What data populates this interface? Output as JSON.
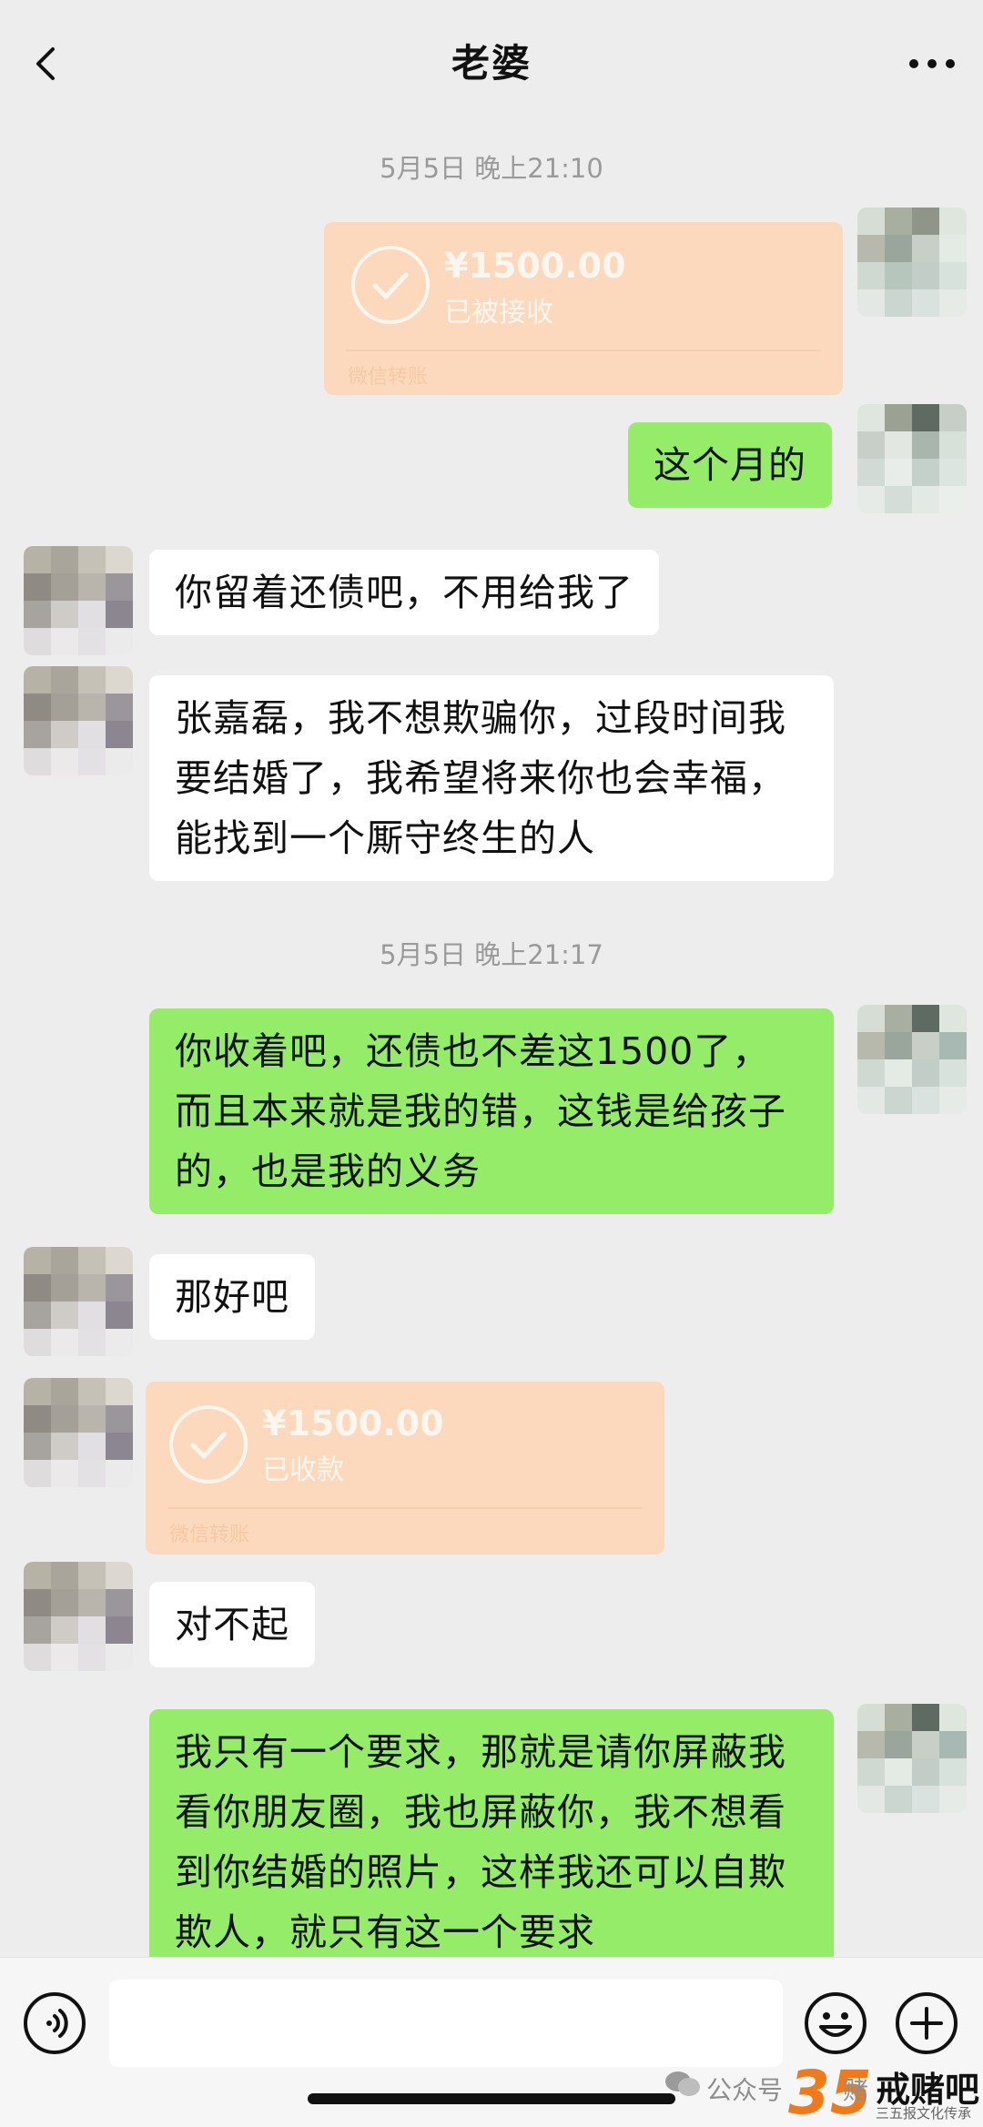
{
  "header": {
    "title": "老婆",
    "back_icon": "chevron-left-icon",
    "more_icon": "more-dots-icon"
  },
  "timestamps": [
    "5月5日 晚上21:10",
    "5月5日 晚上21:17"
  ],
  "messages": {
    "transfer_sent": {
      "amount": "¥1500.00",
      "status": "已被接收",
      "brand": "微信转账"
    },
    "m1": "这个月的",
    "m2": "你留着还债吧，不用给我了",
    "m3": "张嘉磊，我不想欺骗你，过段时间我要结婚了，我希望将来你也会幸福，能找到一个厮守终生的人",
    "m4": "你收着吧，还债也不差这1500了，而且本来就是我的错，这钱是给孩子的，也是我的义务",
    "m5": "那好吧",
    "transfer_received": {
      "amount": "¥1500.00",
      "status": "已收款",
      "brand": "微信转账"
    },
    "m6": "对不起",
    "m7": "我只有一个要求，那就是请你屏蔽我看你朋友圈，我也屏蔽你，我不想看到你结婚的照片，这样我还可以自欺欺人，就只有这一个要求"
  },
  "input_bar": {
    "placeholder": "",
    "voice_icon": "voice-icon",
    "emoji_icon": "emoji-icon",
    "plus_icon": "plus-icon"
  },
  "watermark": {
    "channel": "公众号",
    "channel_suffix": "赌",
    "logo_number": "35",
    "logo_text": "戒赌吧",
    "tagline": "三五报文化传承"
  },
  "colors": {
    "background": "#ededed",
    "own_bubble": "#95ec69",
    "other_bubble": "#ffffff",
    "transfer_card": "#fcd9bd"
  }
}
